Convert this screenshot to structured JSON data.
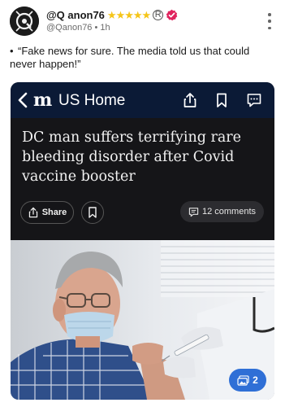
{
  "post": {
    "author_name": "@Q anon76",
    "star_count": 5,
    "registered_mark": "R",
    "handle": "@Qanon76",
    "separator": "•",
    "time": "1h",
    "bullet": "•",
    "text": "“Fake news for sure. The media told us that could never happen!”"
  },
  "card": {
    "nav": {
      "logo": "m",
      "title": "US Home"
    },
    "headline": "DC man suffers terrifying rare bleeding disorder after Covid vaccine booster",
    "share_label": "Share",
    "comments_label": "12 comments",
    "gallery_count": "2"
  },
  "colors": {
    "star": "#f5c518",
    "verified": "#e0245e",
    "nav_bg": "#0b1a36",
    "gallery_badge": "#2f6fd6"
  },
  "icons": {
    "avatar": "q-logo-avatar",
    "verified": "verified-badge-icon",
    "menu": "kebab-menu-icon",
    "back": "back-chevron-icon",
    "share": "share-icon",
    "bookmark": "bookmark-icon",
    "comment": "comment-icon",
    "gallery": "gallery-icon"
  }
}
